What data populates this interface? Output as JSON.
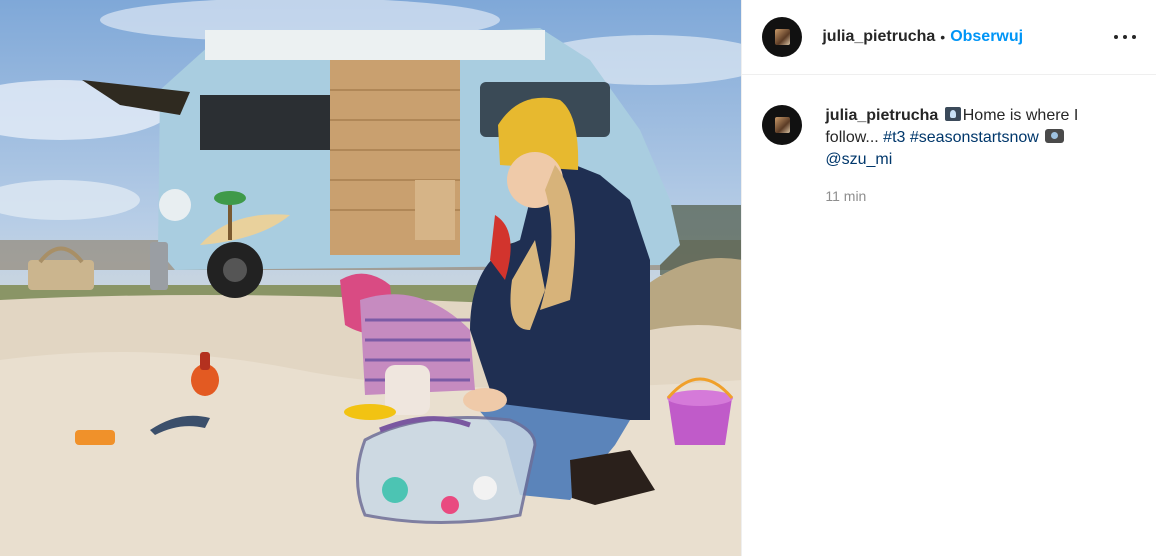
{
  "header": {
    "username": "julia_pietrucha",
    "separator": "•",
    "follow_label": "Obserwuj",
    "more_icon": "more-horizontal-icon"
  },
  "caption": {
    "username": "julia_pietrucha",
    "text": "Home is where I follow...",
    "hashtags": [
      "#t3",
      "#seasonstartsnow"
    ],
    "mention": "@szu_mi",
    "emoji_before_text": "music-note-emoji",
    "emoji_before_mention": "camera-emoji"
  },
  "timestamp": "11 min",
  "colors": {
    "follow": "#0095f6",
    "link": "#00376b",
    "muted": "#8e8e8e",
    "text": "#262626"
  }
}
